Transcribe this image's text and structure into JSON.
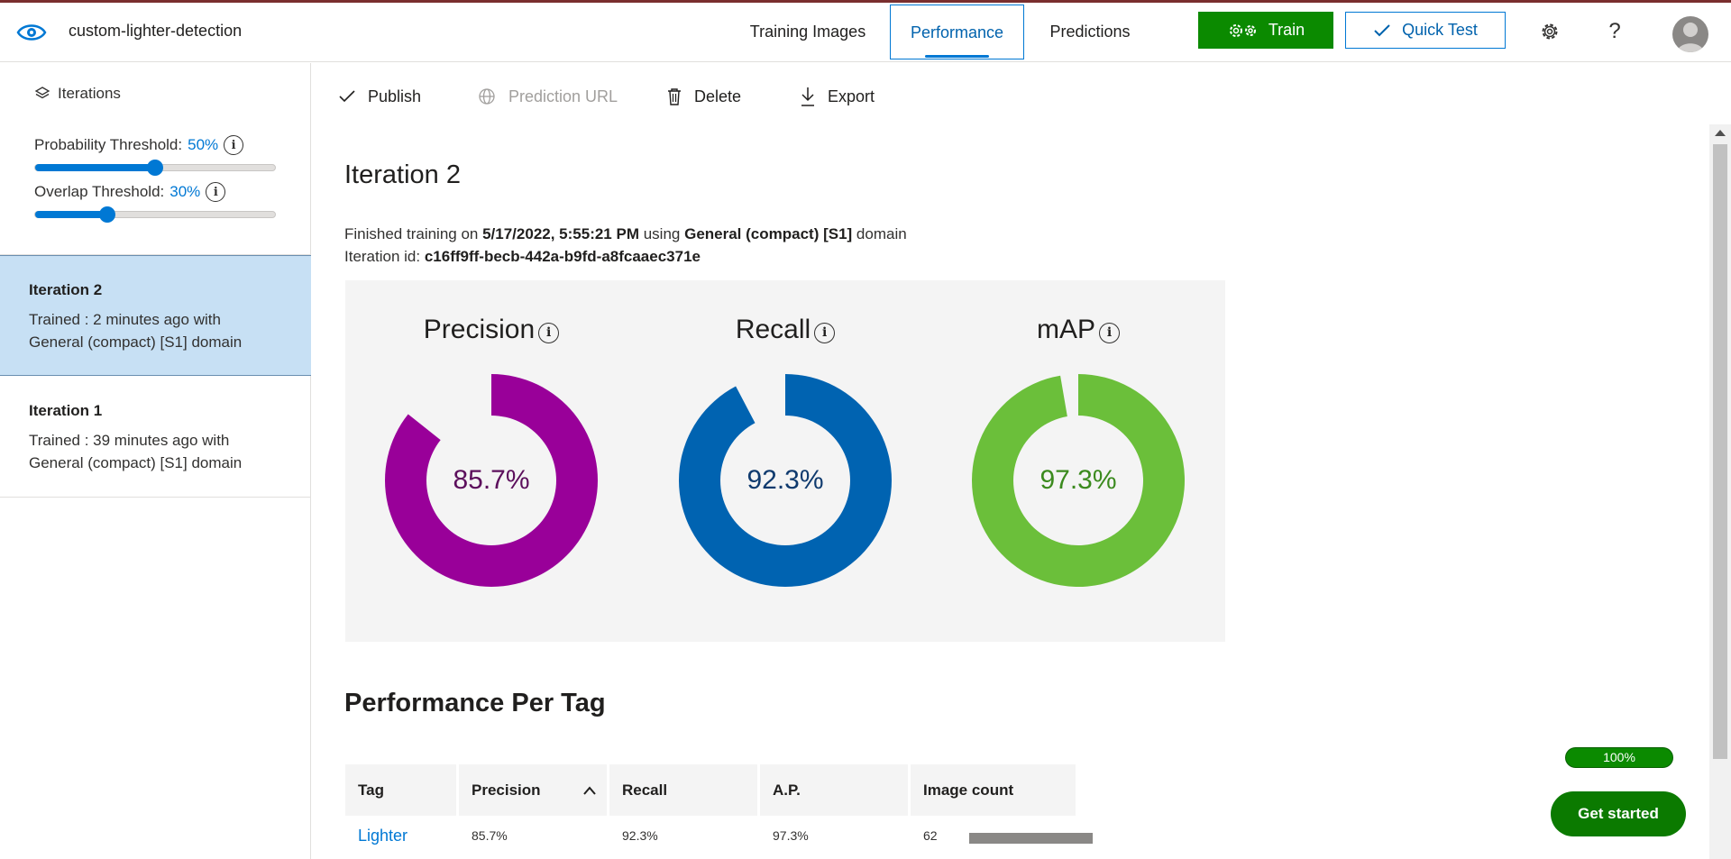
{
  "header": {
    "project_name": "custom-lighter-detection",
    "tabs": [
      {
        "label": "Training Images"
      },
      {
        "label": "Performance"
      },
      {
        "label": "Predictions"
      }
    ],
    "train_label": "Train",
    "quick_test_label": "Quick Test",
    "help_glyph": "?",
    "icons": {
      "logo": "eye-icon",
      "train": "gears-icon",
      "quick_test": "checkmark-icon",
      "settings": "gear-icon",
      "help": "question-icon",
      "avatar": "user-avatar-icon"
    },
    "accent_color": "#0078d4",
    "train_color": "#0b8a00"
  },
  "sidebar": {
    "iterations_label": "Iterations",
    "probability_threshold": {
      "label": "Probability Threshold:",
      "value": "50%",
      "fraction": 0.5
    },
    "overlap_threshold": {
      "label": "Overlap Threshold:",
      "value": "30%",
      "fraction": 0.3
    },
    "iterations": [
      {
        "name": "Iteration 2",
        "desc": "Trained : 2 minutes ago with General (compact) [S1] domain",
        "selected": true
      },
      {
        "name": "Iteration 1",
        "desc": "Trained : 39 minutes ago with General (compact) [S1] domain",
        "selected": false
      }
    ]
  },
  "commands": {
    "publish": "Publish",
    "prediction_url": "Prediction URL",
    "delete": "Delete",
    "export": "Export"
  },
  "main": {
    "iteration_title": "Iteration 2",
    "finished_prefix": "Finished training on ",
    "finished_date": "5/17/2022, 5:55:21 PM",
    "finished_mid": " using ",
    "finished_domain": "General (compact) [S1]",
    "finished_suffix": " domain",
    "iteration_id_prefix": "Iteration id: ",
    "iteration_id": "c16ff9ff-becb-442a-b9fd-a8fcaaec371e",
    "metrics": [
      {
        "title": "Precision",
        "display": "85.7%",
        "value": 0.857,
        "color": "#990099",
        "text_color": "#5c0f5c"
      },
      {
        "title": "Recall",
        "display": "92.3%",
        "value": 0.923,
        "color": "#0063b1",
        "text_color": "#0f3a6e"
      },
      {
        "title": "mAP",
        "display": "97.3%",
        "value": 0.973,
        "color": "#6bbf3a",
        "text_color": "#3b8a1e"
      }
    ],
    "per_tag_title": "Performance Per Tag",
    "table": {
      "headers": [
        "Tag",
        "Precision",
        "Recall",
        "A.P.",
        "Image count"
      ],
      "rows": [
        {
          "tag": "Lighter",
          "precision": "85.7%",
          "recall": "92.3%",
          "ap": "97.3%",
          "count": "62"
        }
      ]
    }
  },
  "progress_pill": "100%",
  "get_started_label": "Get started"
}
